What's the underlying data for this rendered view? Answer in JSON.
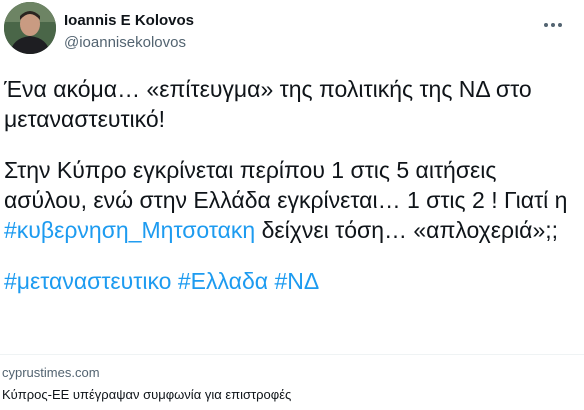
{
  "author": {
    "display_name": "Ioannis E Kolovos",
    "handle": "@ioannisekolovos",
    "avatar_icon": "profile-photo"
  },
  "more_icon": "more-horizontal-icon",
  "tweet": {
    "line1": "Ένα ακόμα… «επίτευγμα» της πολιτικής της ΝΔ στο μεταναστευτικό!",
    "para2_before": "Στην Κύπρο εγκρίνεται περίπου 1 στις 5 αιτήσεις ασύλου, ενώ στην Ελλάδα εγκρίνεται… 1 στις 2 ! Γιατί η ",
    "hashtag_kyvernisi": "#κυβερνηση_Μητσοτακη",
    "para2_after": " δείχνει τόση… «απλοχεριά»;;",
    "hashtags": [
      "#μεταναστευτικο",
      "#Ελλαδα",
      "#ΝΔ"
    ]
  },
  "link_card": {
    "domain": "cyprustimes.com",
    "title": "Κύπρος-ΕΕ υπέγραψαν συμφωνία για επιστροφές"
  },
  "colors": {
    "link": "#1d9bf0",
    "text": "#0f1419",
    "secondary": "#536471"
  }
}
